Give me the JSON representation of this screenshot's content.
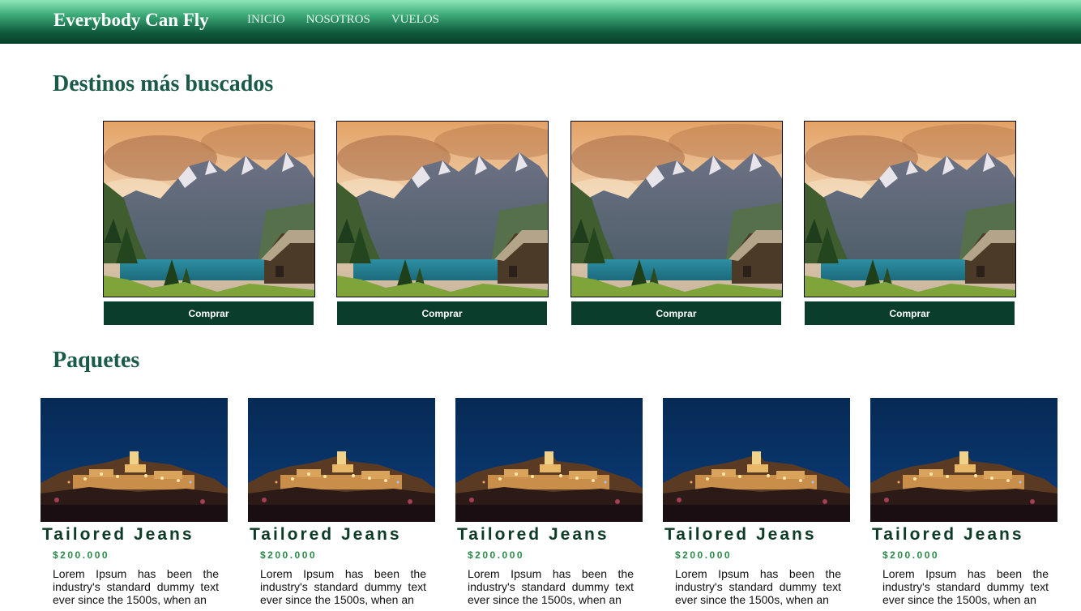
{
  "navbar": {
    "brand": "Everybody Can Fly",
    "links": [
      "INICIO",
      "NOSOTROS",
      "VUELOS"
    ]
  },
  "destinos": {
    "title": "Destinos más buscados",
    "cards": [
      {
        "image": "mountain-lake-photo",
        "button": "Comprar"
      },
      {
        "image": "mountain-lake-photo",
        "button": "Comprar"
      },
      {
        "image": "mountain-lake-photo",
        "button": "Comprar"
      },
      {
        "image": "mountain-lake-photo",
        "button": "Comprar"
      }
    ]
  },
  "paquetes": {
    "title": "Paquetes",
    "cards": [
      {
        "image": "night-village-photo",
        "title": "Tailored Jeans",
        "price": "$200.000",
        "description": "Lorem Ipsum has been the industry's standard dummy text ever since the 1500s, when an"
      },
      {
        "image": "night-village-photo",
        "title": "Tailored Jeans",
        "price": "$200.000",
        "description": "Lorem Ipsum has been the industry's standard dummy text ever since the 1500s, when an"
      },
      {
        "image": "night-village-photo",
        "title": "Tailored Jeans",
        "price": "$200.000",
        "description": "Lorem Ipsum has been the industry's standard dummy text ever since the 1500s, when an"
      },
      {
        "image": "night-village-photo",
        "title": "Tailored Jeans",
        "price": "$200.000",
        "description": "Lorem Ipsum has been the industry's standard dummy text ever since the 1500s, when an"
      },
      {
        "image": "night-village-photo",
        "title": "Tailored Jeans",
        "price": "$200.000",
        "description": "Lorem Ipsum has been the industry's standard dummy text ever since the 1500s, when an"
      }
    ]
  },
  "colors": {
    "nav_dark": "#0a3f2a",
    "nav_light": "#8fe6b8",
    "heading": "#1a5a4a",
    "button": "#0b3d2c",
    "price": "#2d8a4a"
  }
}
